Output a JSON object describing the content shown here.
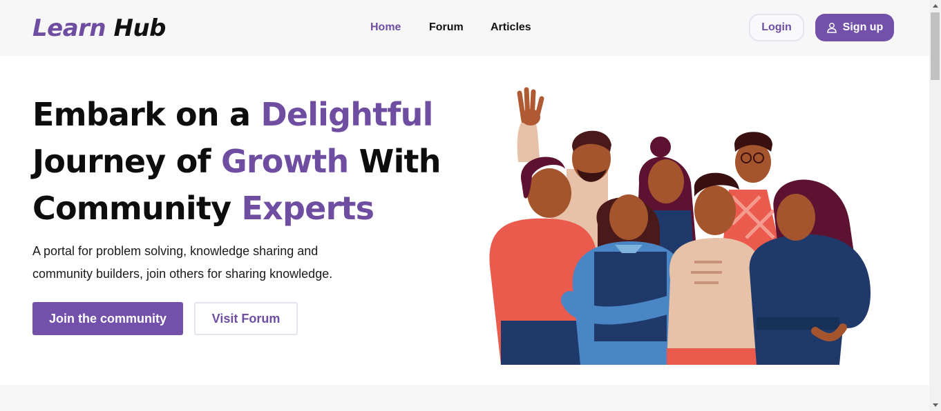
{
  "brand": {
    "part1": "Learn",
    "part2": "Hub"
  },
  "nav": {
    "links": [
      "Home",
      "Forum",
      "Articles"
    ],
    "active": "Home",
    "login_label": "Login",
    "signup_label": "Sign up"
  },
  "hero": {
    "line1_a": "Embark on a ",
    "line1_b": "Delightful",
    "line2_a": "Journey of ",
    "line2_b": "Growth",
    "line2_c": " With",
    "line3_a": "Community ",
    "line3_b": "Experts",
    "subtitle_line1": "A portal for problem solving, knowledge sharing and",
    "subtitle_line2": "community builders, join others for sharing knowledge.",
    "join_label": "Join the community",
    "visit_label": "Visit Forum"
  },
  "illustration": {
    "icon": "community-people-illustration"
  },
  "colors": {
    "accent": "#7350a9",
    "text": "#0d0d0d",
    "nav_bg": "#f7f7f8"
  }
}
